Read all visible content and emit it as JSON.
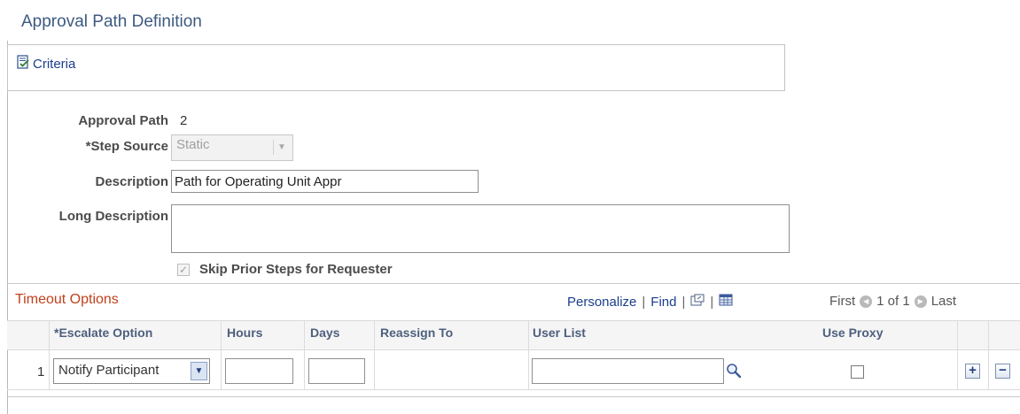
{
  "page": {
    "title": "Approval Path Definition"
  },
  "criteria": {
    "label": "Criteria"
  },
  "form": {
    "approval_path_label": "Approval Path",
    "approval_path_value": "2",
    "step_source_label": "*Step Source",
    "step_source_value": "Static",
    "description_label": "Description",
    "description_value": "Path for Operating Unit Appr",
    "long_description_label": "Long Description",
    "long_description_value": "",
    "skip_prior_label": "Skip Prior Steps for Requester",
    "skip_prior_checked": true
  },
  "timeout_grid": {
    "title": "Timeout Options",
    "toolbar": {
      "personalize": "Personalize",
      "find": "Find",
      "sep": "|",
      "first": "First",
      "range": "1 of 1",
      "last": "Last"
    },
    "columns": [
      "*Escalate Option",
      "Hours",
      "Days",
      "Reassign To",
      "User List",
      "Use Proxy"
    ],
    "rows": [
      {
        "num": "1",
        "escalate_option": "Notify Participant",
        "hours": "",
        "days": "",
        "reassign_to": "",
        "user_list": "",
        "use_proxy": false
      }
    ]
  },
  "icons": {
    "criteria": "document-check-icon",
    "lookup": "magnifier-icon",
    "add_row": "plus-icon",
    "delete_row": "minus-icon",
    "view_all": "new-window-icon",
    "download": "spreadsheet-icon"
  },
  "colors": {
    "title": "#3d5a80",
    "link": "#1a3e8c",
    "grid_title": "#c0411c"
  }
}
